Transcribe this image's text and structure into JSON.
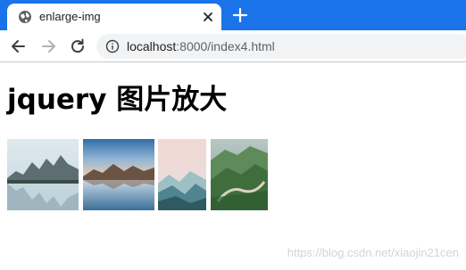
{
  "browser": {
    "tab": {
      "title": "enlarge-img"
    },
    "address": {
      "host": "localhost",
      "rest": ":8000/index4.html"
    },
    "colors": {
      "tabbar": "#1a73e8",
      "omnibox": "#f1f3f4"
    }
  },
  "page": {
    "heading": "jquery 图片放大",
    "images": [
      {
        "name": "mountain-lake-reflection"
      },
      {
        "name": "sunset-lake-mountains"
      },
      {
        "name": "misty-mountain-valley"
      },
      {
        "name": "green-mountain-road"
      }
    ]
  },
  "watermark": "https://blog.csdn.net/xiaojin21cen"
}
